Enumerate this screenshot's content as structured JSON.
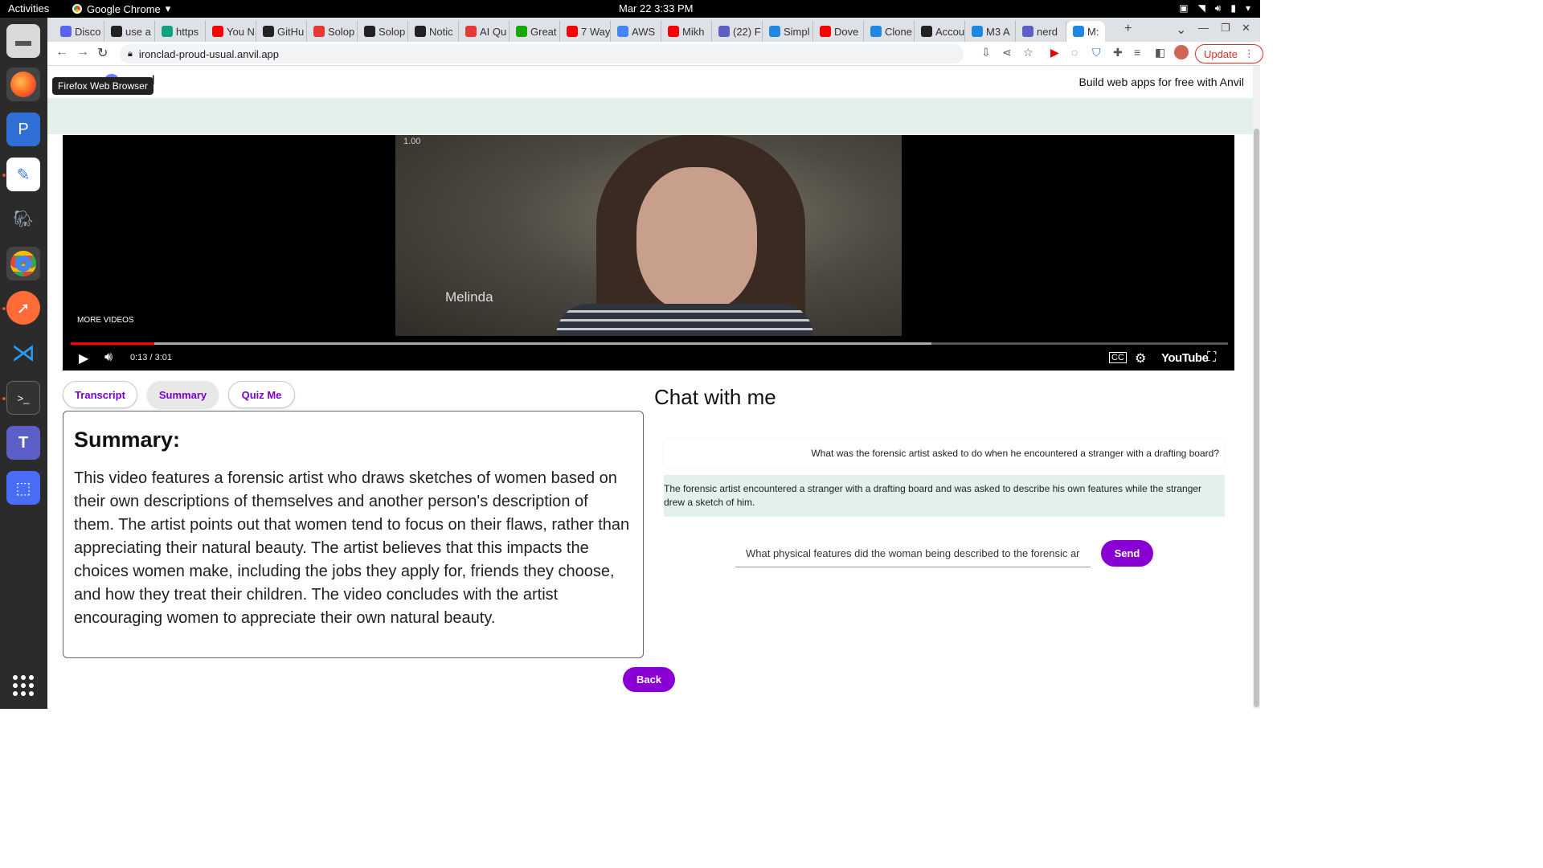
{
  "topbar": {
    "activities": "Activities",
    "app_name": "Google Chrome",
    "clock": "Mar 22  3:33 PM"
  },
  "dock": {
    "tooltip": "Firefox Web Browser"
  },
  "browser": {
    "tabs": [
      {
        "label": "Disco",
        "color": "#5865f2"
      },
      {
        "label": "use a",
        "color": "#222222"
      },
      {
        "label": "https",
        "color": "#10a37f"
      },
      {
        "label": "You N",
        "color": "#ff0000"
      },
      {
        "label": "GitHu",
        "color": "#222222"
      },
      {
        "label": "Solop",
        "color": "#e53935"
      },
      {
        "label": "Solop",
        "color": "#222222"
      },
      {
        "label": "Notic",
        "color": "#222222"
      },
      {
        "label": "AI Qu",
        "color": "#e53935"
      },
      {
        "label": "Great",
        "color": "#14a800"
      },
      {
        "label": "7 Way",
        "color": "#ff0000"
      },
      {
        "label": "AWS",
        "color": "#4285f4"
      },
      {
        "label": "Mikh",
        "color": "#ff0000"
      },
      {
        "label": "(22) F",
        "color": "#5b5fc7"
      },
      {
        "label": "Simpl",
        "color": "#1e88e5"
      },
      {
        "label": "Dove",
        "color": "#ff0000"
      },
      {
        "label": "Clone",
        "color": "#1e88e5"
      },
      {
        "label": "Accou",
        "color": "#222222"
      },
      {
        "label": "M3 A",
        "color": "#1e88e5"
      },
      {
        "label": "nerd",
        "color": "#5b5fc7"
      },
      {
        "label": "M:",
        "color": "#1e88e5",
        "active": true
      }
    ],
    "url": "ironclad-proud-usual.anvil.app",
    "update_label": "Update"
  },
  "anvil": {
    "logo_tail": "l",
    "banner": "Build web apps for free with Anvil"
  },
  "video": {
    "speed": "1.00",
    "caption": "Melinda",
    "more_videos": "MORE VIDEOS",
    "time": "0:13 / 3:01",
    "progress_played": 0.072,
    "progress_buffered": 0.744,
    "youtube_label": "YouTube"
  },
  "tabs": {
    "transcript": "Transcript",
    "summary": "Summary",
    "quiz": "Quiz Me"
  },
  "summary": {
    "heading": "Summary:",
    "text": "This video features a forensic artist who draws sketches of women based on their own descriptions of themselves and another person's description of them. The artist points out that women tend to focus on their flaws, rather than appreciating their natural beauty. The artist believes that this impacts the choices women make, including the jobs they apply for, friends they choose, and how they treat their children. The video concludes with the artist encouraging women to appreciate their own natural beauty."
  },
  "chat": {
    "title": "Chat with me",
    "question": "What was the forensic artist asked to do when he encountered a stranger with a drafting board?",
    "answer": "The forensic artist encountered a stranger with a drafting board and was asked to describe his own features while the stranger drew a sketch of him.",
    "input_value": "What physical features did the woman being described to the forensic ar",
    "send_label": "Send"
  },
  "back_label": "Back"
}
